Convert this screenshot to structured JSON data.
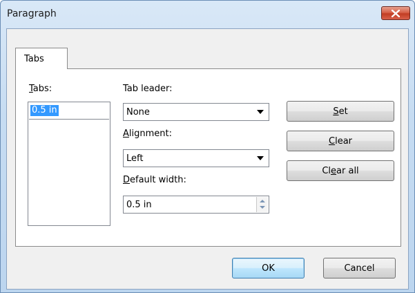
{
  "window": {
    "title": "Paragraph"
  },
  "tabs": {
    "active_tab_label": "Tabs"
  },
  "tab_stops": {
    "label": "Tabs:",
    "label_accel_char": "T",
    "label_rest": "abs:",
    "entries": [
      "0.5 in"
    ],
    "selected_index": 0
  },
  "tab_leader": {
    "label": "Tab leader:",
    "value": "None"
  },
  "alignment": {
    "label": "Alignment:",
    "label_accel_char": "A",
    "label_rest": "lignment:",
    "value": "Left"
  },
  "default_width": {
    "label": "Default width:",
    "label_accel_char": "D",
    "label_rest": "efault width:",
    "value": "0.5 in"
  },
  "buttons": {
    "set": {
      "label": "Set",
      "accel": "S",
      "rest": "et"
    },
    "clear": {
      "label": "Clear",
      "accel": "C",
      "rest": "lear"
    },
    "clear_all": {
      "label": "Clear all",
      "pre": "Cl",
      "accel": "e",
      "rest": "ar all"
    },
    "ok": "OK",
    "cancel": "Cancel"
  },
  "colors": {
    "close_button": "#c94a32",
    "selection": "#3399ff",
    "title_bar": "#c6dcf2"
  },
  "icons": {
    "close": "close-icon",
    "dropdown": "chevron-down-icon",
    "spin": "spin-arrows-icon"
  }
}
